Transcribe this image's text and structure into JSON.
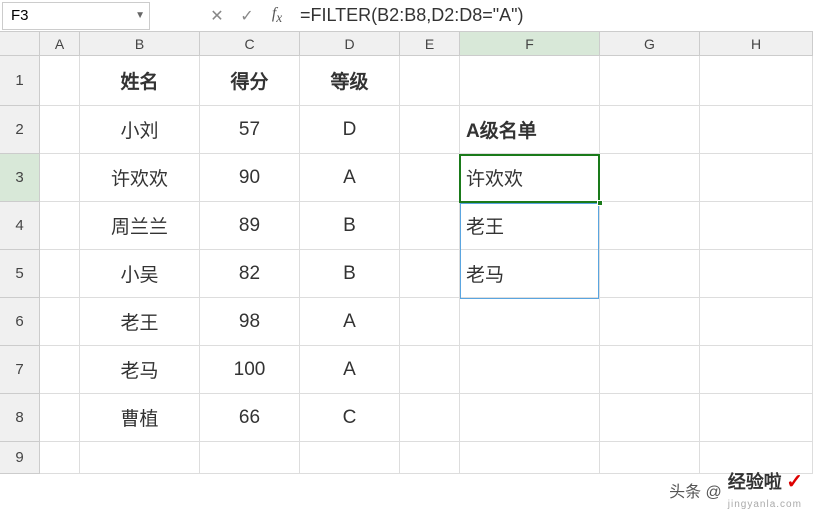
{
  "name_box": "F3",
  "formula": "=FILTER(B2:B8,D2:D8=\"A\")",
  "columns": [
    "A",
    "B",
    "C",
    "D",
    "E",
    "F",
    "G",
    "H"
  ],
  "rows": [
    "1",
    "2",
    "3",
    "4",
    "5",
    "6",
    "7",
    "8",
    "9"
  ],
  "active_col": "F",
  "active_row": "3",
  "table": {
    "headers": [
      "姓名",
      "得分",
      "等级"
    ],
    "rows": [
      {
        "name": "小刘",
        "score": "57",
        "grade": "D"
      },
      {
        "name": "许欢欢",
        "score": "90",
        "grade": "A"
      },
      {
        "name": "周兰兰",
        "score": "89",
        "grade": "B"
      },
      {
        "name": "小吴",
        "score": "82",
        "grade": "B"
      },
      {
        "name": "老王",
        "score": "98",
        "grade": "A"
      },
      {
        "name": "老马",
        "score": "100",
        "grade": "A"
      },
      {
        "name": "曹植",
        "score": "66",
        "grade": "C"
      }
    ]
  },
  "result": {
    "title": "A级名单",
    "items": [
      "许欢欢",
      "老王",
      "老马"
    ]
  },
  "watermark": {
    "source": "头条",
    "main": "经验啦",
    "sub": "jingyanla.com"
  }
}
